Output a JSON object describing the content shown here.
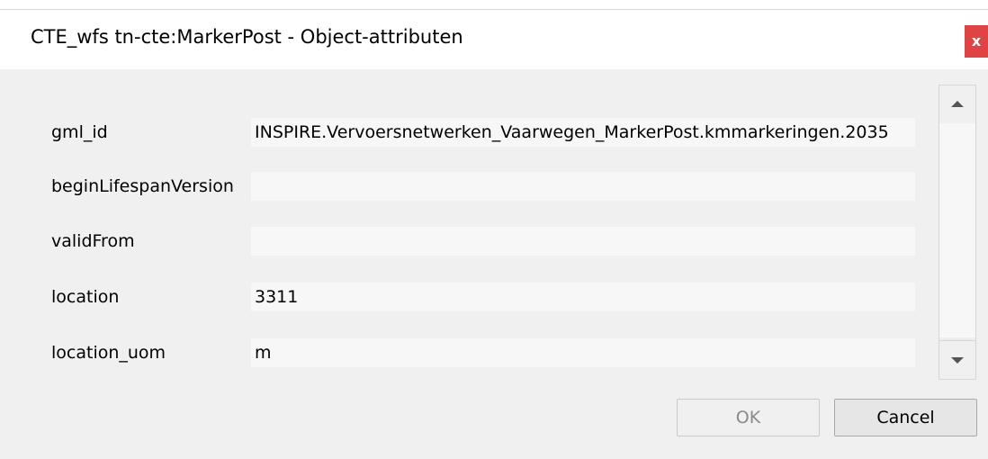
{
  "window": {
    "title": "CTE_wfs tn-cte:MarkerPost - Object-attributen",
    "close_label": "x"
  },
  "fields": [
    {
      "label": "gml_id",
      "value": "INSPIRE.Vervoersnetwerken_Vaarwegen_MarkerPost.kmmarkeringen.2035"
    },
    {
      "label": "beginLifespanVersion",
      "value": ""
    },
    {
      "label": "validFrom",
      "value": ""
    },
    {
      "label": "location",
      "value": "3311"
    },
    {
      "label": "location_uom",
      "value": "m"
    }
  ],
  "buttons": {
    "ok_label": "OK",
    "cancel_label": "Cancel"
  },
  "icons": {
    "close": "close-icon",
    "scroll_up": "arrow-up-icon",
    "scroll_down": "arrow-down-icon"
  },
  "colors": {
    "close_button": "#e04343",
    "field_background": "#f7f7f7",
    "dialog_background": "#f0f0f0"
  }
}
